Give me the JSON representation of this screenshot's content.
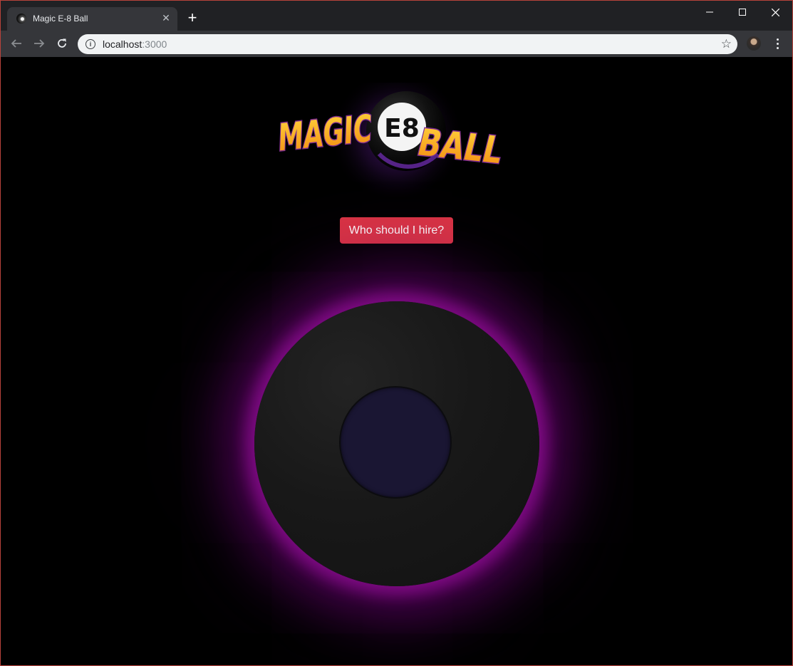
{
  "browser": {
    "tab_title": "Magic E-8 Ball",
    "tab_close": "✕",
    "new_tab": "+",
    "url_host": "localhost",
    "url_port": ":3000",
    "icons": [
      "favicon-icon",
      "close-icon",
      "plus-icon",
      "minimize-icon",
      "maximize-icon",
      "close-window-icon",
      "back-icon",
      "forward-icon",
      "reload-icon",
      "info-icon",
      "star-icon",
      "profile-avatar",
      "menu-icon"
    ]
  },
  "logo": {
    "word_left": "MAGIC",
    "ball_text": "E8",
    "word_right": "BALL",
    "colors": {
      "letters": "#f7a21b",
      "letter_highlight": "#ffd23c",
      "outline": "#7b2a8f",
      "glow": "#8a2be2"
    }
  },
  "ask_button": {
    "label": "Who should I hire?",
    "color": "#dc3545"
  },
  "ball": {
    "colors": {
      "body": "#161616",
      "glow": "#8b0a8f",
      "window": "#1a1633"
    }
  }
}
